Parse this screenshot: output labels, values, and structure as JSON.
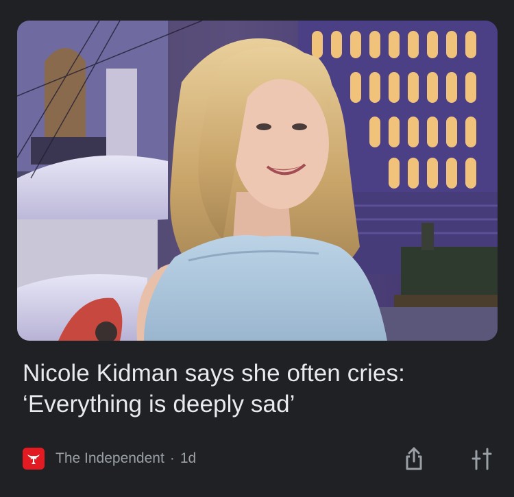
{
  "article": {
    "headline": "Nicole Kidman says she often cries: ‘Everything is deeply sad’",
    "image_icon": "photo-portrait-woman-icon"
  },
  "source": {
    "publisher": "The Independent",
    "separator": "·",
    "age": "1d",
    "logo_icon": "eagle-logo-icon",
    "logo_color": "#e21b23"
  },
  "actions": {
    "share_icon": "share-icon",
    "tune_icon": "tune-icon"
  },
  "colors": {
    "background": "#202124",
    "headline": "#e8eaed",
    "meta": "#9aa0a6"
  }
}
